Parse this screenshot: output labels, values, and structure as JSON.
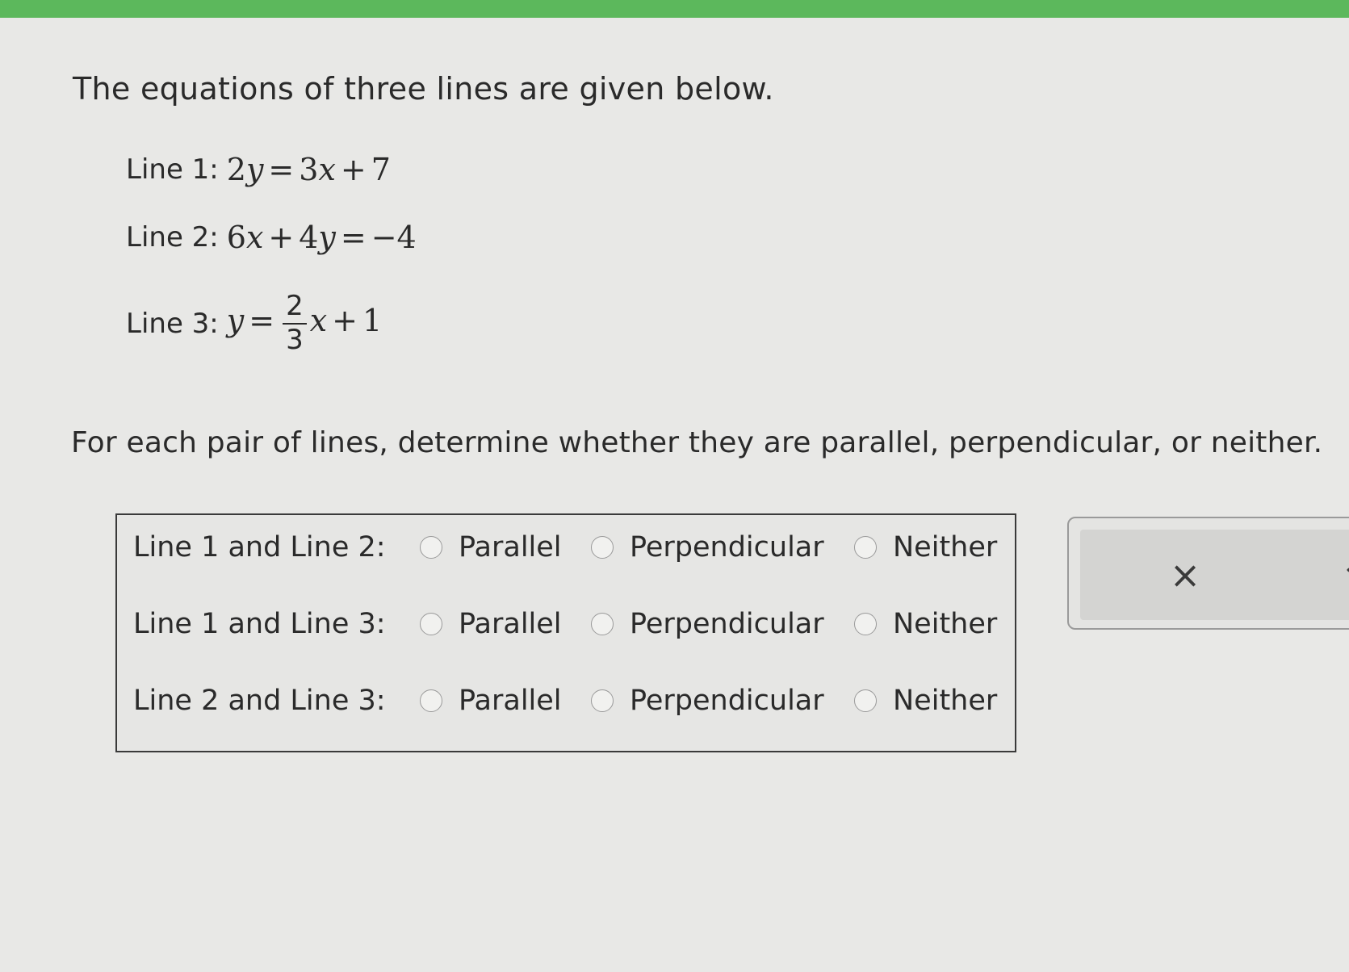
{
  "intro": "The equations of three lines are given below.",
  "lines": [
    {
      "label": "Line 1:",
      "parts": [
        {
          "v": "2"
        },
        {
          "v": "y",
          "it": true
        },
        {
          "v": "="
        },
        {
          "v": "3"
        },
        {
          "v": "x",
          "it": true
        },
        {
          "v": "+"
        },
        {
          "v": "7"
        }
      ]
    },
    {
      "label": "Line 2:",
      "parts": [
        {
          "v": "6"
        },
        {
          "v": "x",
          "it": true
        },
        {
          "v": "+"
        },
        {
          "v": "4"
        },
        {
          "v": "y",
          "it": true
        },
        {
          "v": "="
        },
        {
          "v": "−4"
        }
      ]
    },
    {
      "label": "Line 3:",
      "parts": [
        {
          "v": "y",
          "it": true
        },
        {
          "v": "="
        },
        {
          "frac": [
            "2",
            "3"
          ]
        },
        {
          "v": "x",
          "it": true
        },
        {
          "v": "+"
        },
        {
          "v": "1"
        }
      ]
    }
  ],
  "instruction": "For each pair of lines, determine whether they are parallel, perpendicular, or neither.",
  "pairs": [
    {
      "label": "Line 1 and Line 2:",
      "options": [
        "Parallel",
        "Perpendicular",
        "Neither"
      ]
    },
    {
      "label": "Line 1 and Line 3:",
      "options": [
        "Parallel",
        "Perpendicular",
        "Neither"
      ]
    },
    {
      "label": "Line 2 and Line 3:",
      "options": [
        "Parallel",
        "Perpendicular",
        "Neither"
      ]
    }
  ],
  "controls": {
    "close_icon": "close-icon",
    "close_glyph": "×",
    "undo_icon": "undo-icon"
  }
}
